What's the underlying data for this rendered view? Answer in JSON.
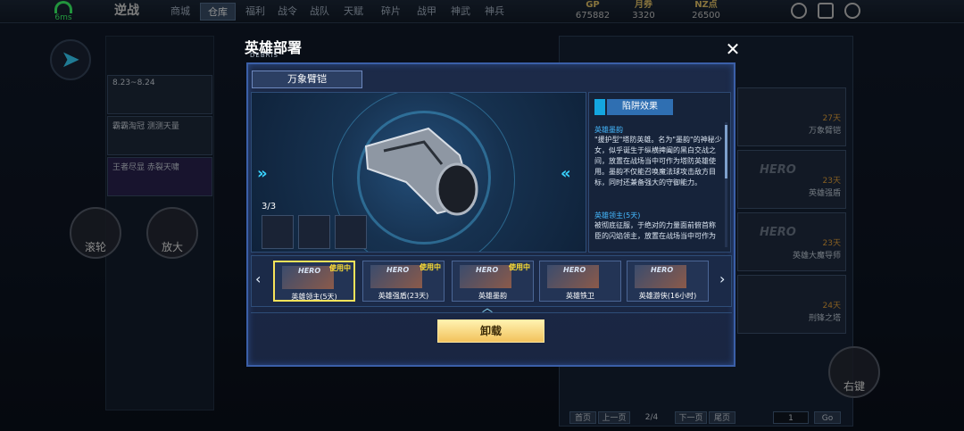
{
  "status": {
    "ping": "6ms"
  },
  "top_bar": {
    "logo": "逆战",
    "tabs": [
      {
        "label": "商城",
        "active": false
      },
      {
        "label": "仓库",
        "active": true
      },
      {
        "label": "福利",
        "active": false
      },
      {
        "label": "战令",
        "active": false
      },
      {
        "label": "战队",
        "active": false
      },
      {
        "label": "天赋",
        "active": false
      },
      {
        "label": "碎片",
        "active": false
      },
      {
        "label": "战甲",
        "active": false
      },
      {
        "label": "神武",
        "active": false
      },
      {
        "label": "神兵",
        "active": false
      }
    ],
    "currencies": [
      {
        "name": "GP",
        "value": "675882"
      },
      {
        "name": "月券",
        "value": "3320"
      },
      {
        "name": "NZ点",
        "value": "26500"
      }
    ]
  },
  "left_panel": {
    "promos": [
      "8.23~8.24",
      "霸霸淘冠 测测天量",
      "王者尽显 赤裂天啸"
    ],
    "float_scroll": "滚轮",
    "float_zoom": "放大"
  },
  "right_panel": {
    "cards": [
      {
        "days": "27天",
        "name": "万象臂铠"
      },
      {
        "days": "23天",
        "name": "英雄强盾"
      },
      {
        "days": "23天",
        "name": "英雄大魔导师"
      },
      {
        "days": "24天",
        "name": "刑锋之塔"
      }
    ],
    "pager": [
      "首页",
      "上一页",
      "下一页",
      "尾页",
      "Go"
    ],
    "page_indicator": "2/4",
    "page_input": "1",
    "right_key": "右键"
  },
  "modal": {
    "title": "英雄部署",
    "subtitle": "DEBRIS",
    "item_name": "万象臂铠",
    "count": "3/3",
    "info": {
      "header": "陷阱效果",
      "entry1_name": "英雄墨韵",
      "entry1_text": "\"援护型\"塔防英雄。名为\"墨韵\"的神秘少女，似乎诞生于纵横捭阖的黑白交战之间，放置在战场当中可作为塔防英雄使用。墨韵不仅能召唤魔法球攻击敌方目标，同时还兼备强大的守御能力。",
      "entry2_name": "英雄领主(5天)",
      "entry2_text": "被彻底征服，于绝对的力量面前俯首称臣的闪焰领主，放置在战场当中可作为"
    },
    "heroes": [
      {
        "label": "英雄领主(5天)",
        "in_use": "使用中",
        "selected": true
      },
      {
        "label": "英雄强盾(23天)",
        "in_use": "使用中",
        "selected": false
      },
      {
        "label": "英雄墨韵",
        "in_use": "使用中",
        "selected": false
      },
      {
        "label": "英雄铁卫",
        "in_use": "",
        "selected": false
      },
      {
        "label": "英雄游侠(16小时)",
        "in_use": "",
        "selected": false
      }
    ],
    "hero_tag": "HERO",
    "unload_label": "卸载"
  }
}
